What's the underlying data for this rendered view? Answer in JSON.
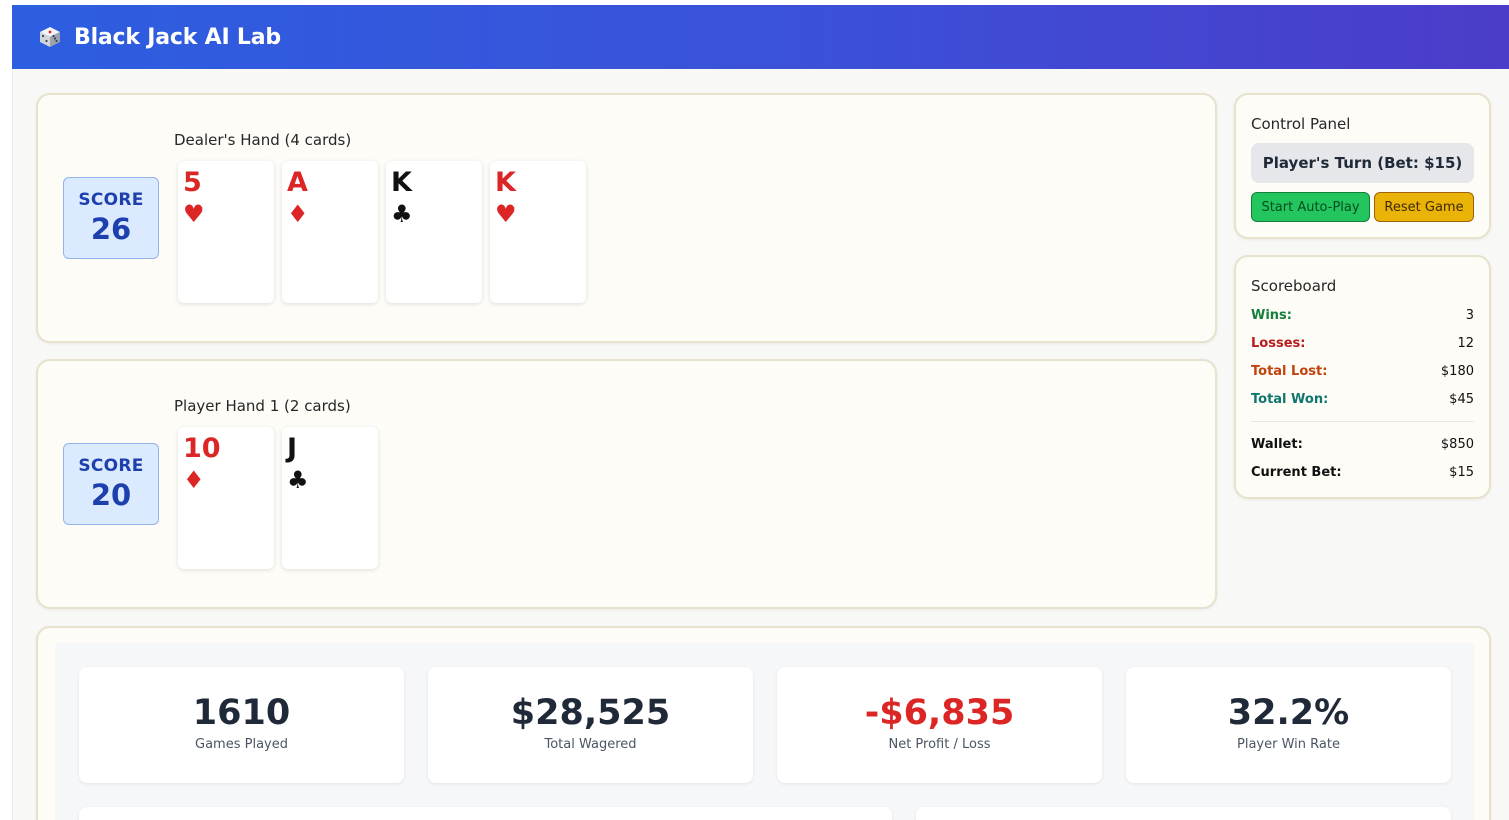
{
  "app": {
    "title": "Black Jack AI Lab",
    "icon": "die-icon"
  },
  "dealer": {
    "title": "Dealer's Hand (4 cards)",
    "score_label": "SCORE",
    "score": "26",
    "cards": [
      {
        "rank": "5",
        "suit": "♥",
        "color": "red"
      },
      {
        "rank": "A",
        "suit": "♦",
        "color": "red"
      },
      {
        "rank": "K",
        "suit": "♣",
        "color": "black"
      },
      {
        "rank": "K",
        "suit": "♥",
        "color": "red"
      }
    ]
  },
  "player": {
    "title": "Player Hand 1 (2 cards)",
    "score_label": "SCORE",
    "score": "20",
    "cards": [
      {
        "rank": "10",
        "suit": "♦",
        "color": "red"
      },
      {
        "rank": "J",
        "suit": "♣",
        "color": "black"
      }
    ]
  },
  "control_panel": {
    "title": "Control Panel",
    "status": "Player's Turn (Bet: $15)",
    "auto_play_label": "Start Auto-Play",
    "reset_label": "Reset Game"
  },
  "scoreboard": {
    "title": "Scoreboard",
    "rows": [
      {
        "label": "Wins:",
        "value": "3"
      },
      {
        "label": "Losses:",
        "value": "12"
      },
      {
        "label": "Total Lost:",
        "value": "$180"
      },
      {
        "label": "Total Won:",
        "value": "$45"
      },
      {
        "label": "Wallet:",
        "value": "$850"
      },
      {
        "label": "Current Bet:",
        "value": "$15"
      }
    ]
  },
  "stats": [
    {
      "value": "1610",
      "label": "Games Played"
    },
    {
      "value": "$28,525",
      "label": "Total Wagered"
    },
    {
      "value": "-$6,835",
      "label": "Net Profit / Loss"
    },
    {
      "value": "32.2%",
      "label": "Player Win Rate"
    }
  ],
  "colors": {
    "header_start": "#2d5ee0",
    "header_end": "#4b3cc9",
    "red_suit": "#dc2626",
    "black_suit": "#111111",
    "score_bg": "#dbeafe",
    "score_text": "#1e40af",
    "win": "#15803d",
    "loss": "#b91c1c",
    "auto_play_btn": "#22c55e",
    "reset_btn": "#eab308"
  }
}
